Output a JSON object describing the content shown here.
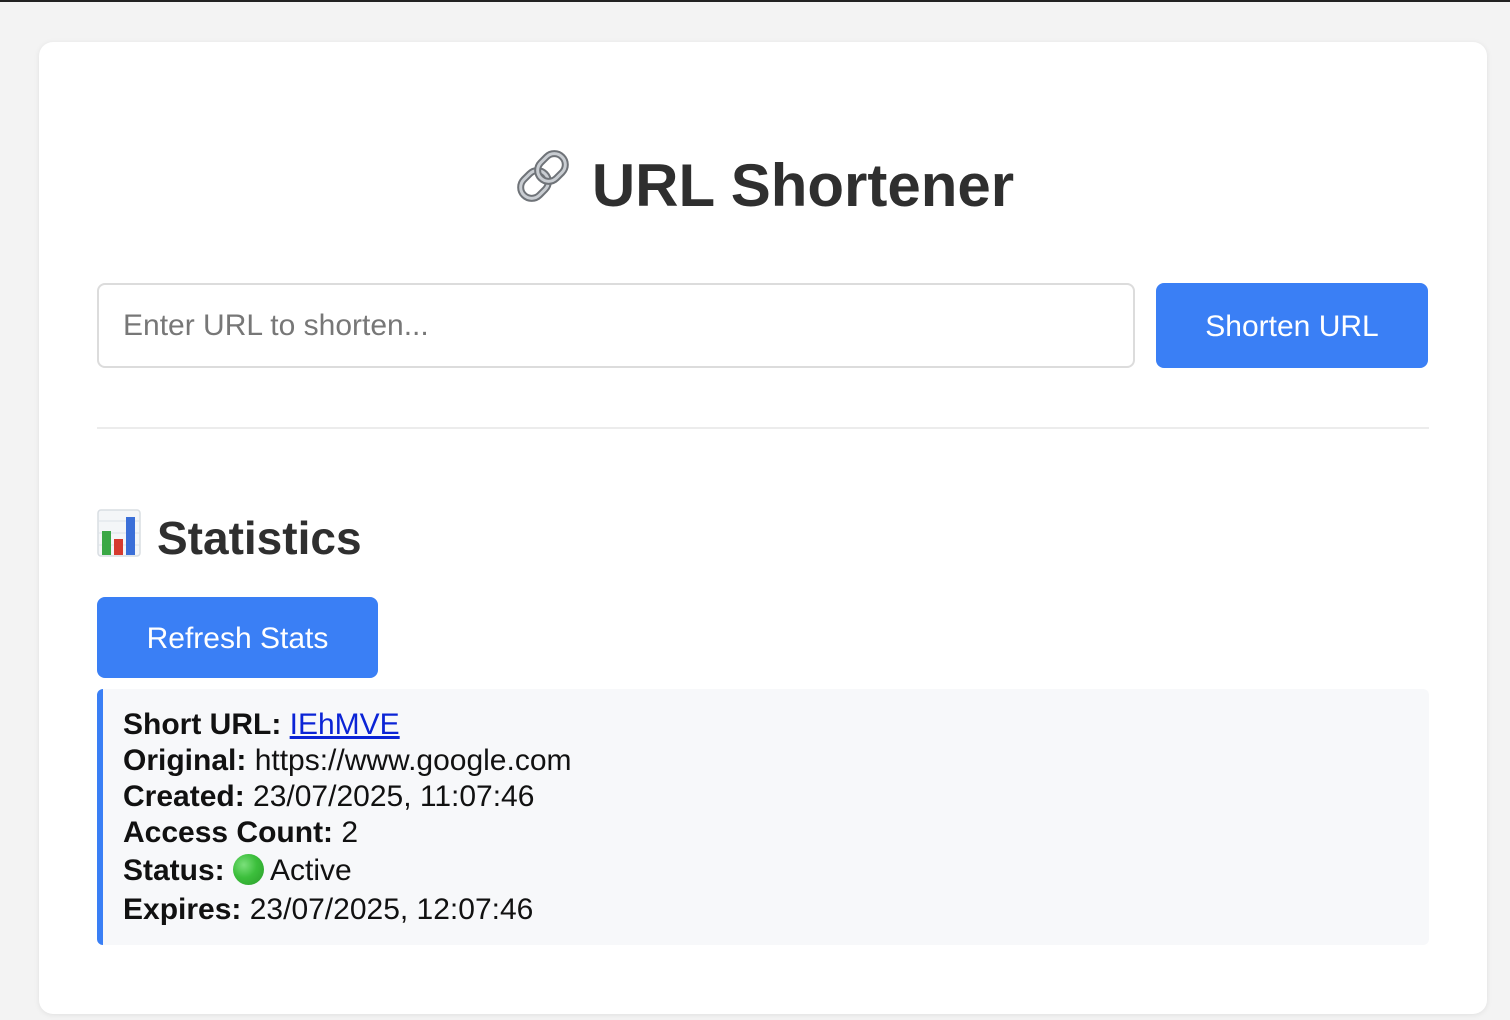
{
  "app": {
    "title": "URL Shortener",
    "title_icon": "link-icon"
  },
  "shorten_form": {
    "input_value": "",
    "input_placeholder": "Enter URL to shorten...",
    "button_label": "Shorten URL"
  },
  "statistics": {
    "heading": "Statistics",
    "heading_icon": "bar-chart-icon",
    "refresh_label": "Refresh Stats",
    "entry": {
      "short_url_label": "Short URL:",
      "short_url_value": "IEhMVE",
      "original_label": "Original:",
      "original_value": "https://www.google.com",
      "created_label": "Created:",
      "created_value": "23/07/2025, 11:07:46",
      "access_count_label": "Access Count:",
      "access_count_value": "2",
      "status_label": "Status:",
      "status_icon": "green-circle-icon",
      "status_value": "Active",
      "expires_label": "Expires:",
      "expires_value": "23/07/2025, 12:07:46"
    }
  },
  "colors": {
    "accent": "#3a7ff5",
    "page_background": "#f3f3f3",
    "card_background": "#ffffff",
    "stats_background": "#f7f8fa",
    "link": "#0b24d6",
    "status_active": "#3cbf3c"
  }
}
